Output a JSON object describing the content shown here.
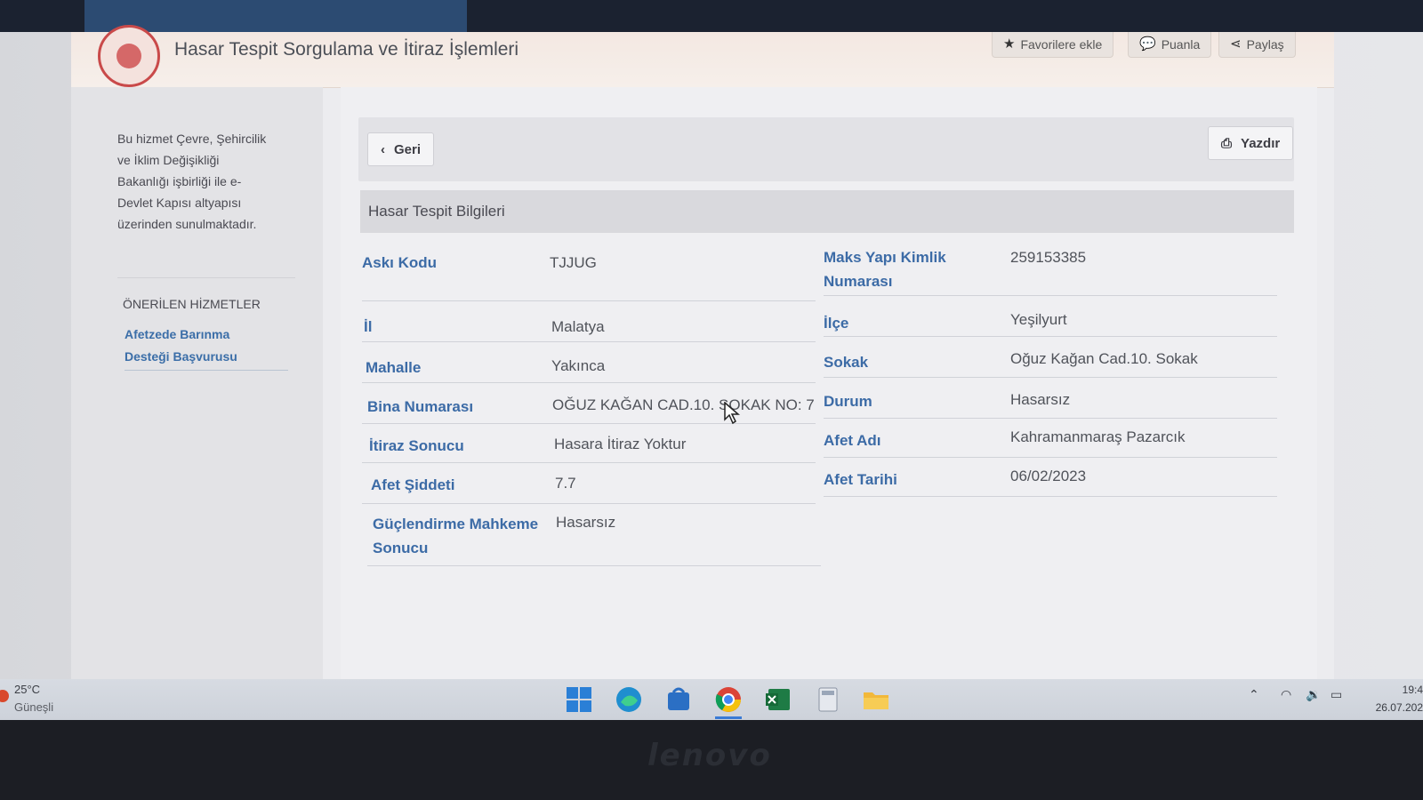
{
  "header": {
    "title": "Hasar Tespit Sorgulama ve İtiraz İşlemleri",
    "favorite_label": "Favorilere ekle",
    "rate_label": "Puanla",
    "share_label": "Paylaş"
  },
  "sidebar": {
    "about_lines": [
      "Bu hizmet Çevre, Şehircilik",
      "ve İklim Değişikliği",
      "Bakanlığı işbirliği ile e-",
      "Devlet Kapısı altyapısı",
      "üzerinden sunulmaktadır."
    ],
    "recommended_heading": "ÖNERİLEN HİZMETLER",
    "recommended_link_lines": [
      "Afetzede Barınma",
      "Desteği Başvurusu"
    ]
  },
  "toolbar": {
    "back_label": "Geri",
    "print_label": "Yazdır"
  },
  "section": {
    "title": "Hasar Tespit Bilgileri"
  },
  "fields": {
    "aski_kodu": {
      "label": "Askı Kodu",
      "value": "TJJUG"
    },
    "maks_yapi": {
      "label_lines": [
        "Maks Yapı Kimlik",
        "Numarası"
      ],
      "value": "259153385"
    },
    "il": {
      "label": "İl",
      "value": "Malatya"
    },
    "ilce": {
      "label": "İlçe",
      "value": "Yeşilyurt"
    },
    "mahalle": {
      "label": "Mahalle",
      "value": "Yakınca"
    },
    "sokak": {
      "label": "Sokak",
      "value": "Oğuz Kağan Cad.10. Sokak"
    },
    "bina": {
      "label": "Bina Numarası",
      "value": "OĞUZ KAĞAN CAD.10. SOKAK NO: 7"
    },
    "durum": {
      "label": "Durum",
      "value": "Hasarsız"
    },
    "itiraz": {
      "label": "İtiraz Sonucu",
      "value": "Hasara İtiraz Yoktur"
    },
    "afet_adi": {
      "label": "Afet Adı",
      "value": "Kahramanmaraş Pazarcık"
    },
    "afet_siddeti": {
      "label": "Afet Şiddeti",
      "value": "7.7"
    },
    "afet_tarihi": {
      "label": "Afet Tarihi",
      "value": "06/02/2023"
    },
    "guclendirme": {
      "label_lines": [
        "Güçlendirme Mahkeme",
        "Sonucu"
      ],
      "value": "Hasarsız"
    }
  },
  "taskbar": {
    "temperature": "25°C",
    "weather": "Güneşli",
    "time": "19:4",
    "date": "26.07.202"
  },
  "device": {
    "brand": "lenovo"
  }
}
